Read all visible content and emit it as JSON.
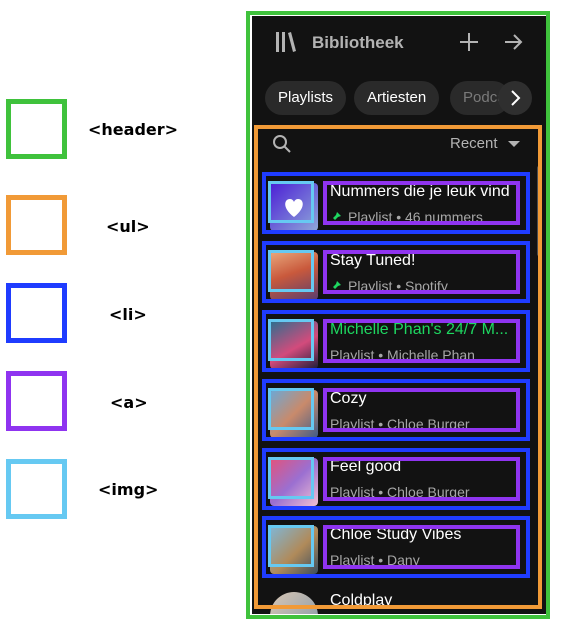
{
  "legend": [
    {
      "key": "header",
      "label": "<header>",
      "color": "#3fc23c"
    },
    {
      "key": "ul",
      "label": "<ul>",
      "color": "#f19a37"
    },
    {
      "key": "li",
      "label": "<li>",
      "color": "#1f3cff"
    },
    {
      "key": "a",
      "label": "<a>",
      "color": "#8f34f0"
    },
    {
      "key": "img",
      "label": "<img>",
      "color": "#66c9f2"
    }
  ],
  "header": {
    "title": "Bibliotheek",
    "library_icon": "library-icon",
    "add_icon": "plus-icon",
    "expand_icon": "arrow-right-icon"
  },
  "filters": {
    "chips": [
      "Playlists",
      "Artiesten",
      "Podcasts"
    ],
    "next_icon": "chevron-right-icon"
  },
  "toolbar": {
    "search_icon": "search-icon",
    "sort_label": "Recent",
    "sort_icon": "caret-down-icon"
  },
  "items": [
    {
      "title": "Nummers die je leuk vind",
      "subtitle": "Playlist • 46 nummers",
      "pinned": true,
      "title_color": "#ffffff"
    },
    {
      "title": "Stay Tuned!",
      "subtitle": "Playlist • Spotify",
      "pinned": true,
      "title_color": "#ffffff"
    },
    {
      "title": "Michelle Phan's 24/7 M...",
      "subtitle": "Playlist • Michelle Phan",
      "pinned": false,
      "title_color": "#1ed760"
    },
    {
      "title": "Cozy",
      "subtitle": "Playlist • Chloe Burger",
      "pinned": false,
      "title_color": "#ffffff"
    },
    {
      "title": "Feel good",
      "subtitle": "Playlist • Chloe Burger",
      "pinned": false,
      "title_color": "#ffffff"
    },
    {
      "title": "Chloe Study Vibes",
      "subtitle": "Playlist • Dany",
      "pinned": false,
      "title_color": "#ffffff"
    },
    {
      "title": "Coldplay",
      "subtitle": "",
      "pinned": false,
      "title_color": "#ffffff"
    }
  ],
  "colors": {
    "background": "#121212",
    "accent_green": "#1ed760",
    "chip_bg": "#2a2a2a",
    "text_muted": "#a7a7a7"
  }
}
